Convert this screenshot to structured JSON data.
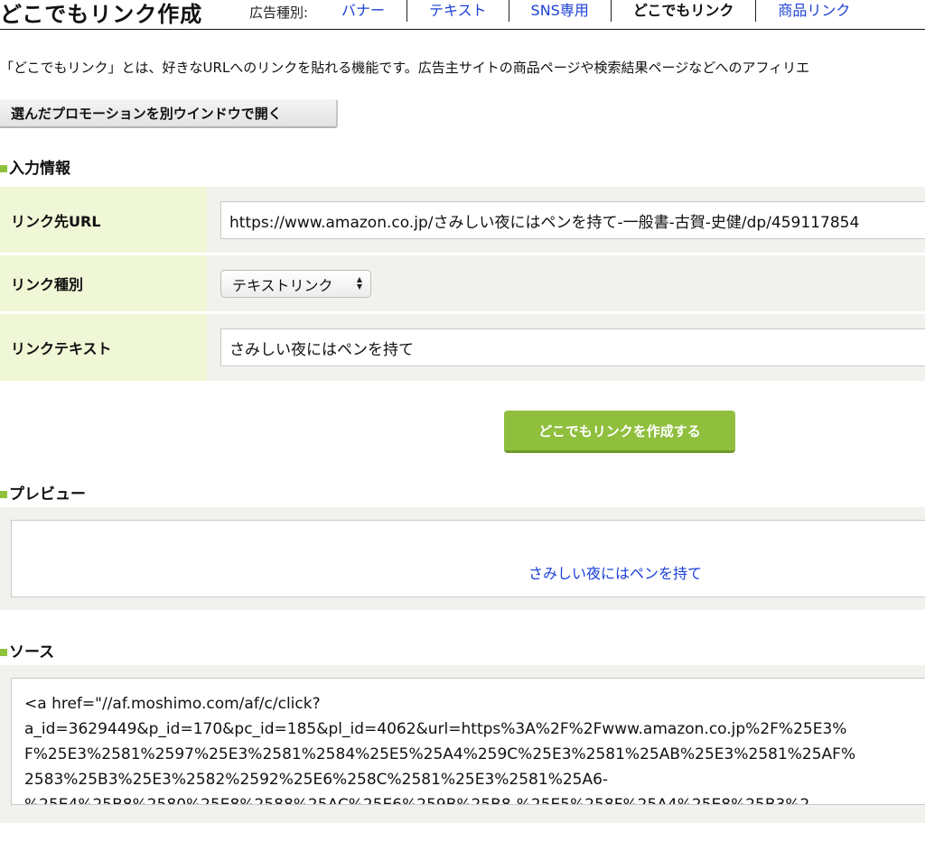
{
  "header": {
    "title": "どこでもリンク作成",
    "ad_type_label": "広告種別:",
    "tabs": [
      {
        "label": "バナー"
      },
      {
        "label": "テキスト"
      },
      {
        "label": "SNS専用"
      },
      {
        "label": "どこでもリンク"
      },
      {
        "label": "商品リンク"
      }
    ]
  },
  "intro_text": "「どこでもリンク」とは、好きなURLへのリンクを貼れる機能です。広告主サイトの商品ページや検索結果ページなどへのアフィリエ",
  "open_window_button": "選んだプロモーションを別ウインドウで開く",
  "input_section": {
    "heading": "入力情報",
    "url_label": "リンク先URL",
    "url_value": "https://www.amazon.co.jp/さみしい夜にはペンを持て-一般書-古賀-史健/dp/459117854",
    "type_label": "リンク種別",
    "type_selected": "テキストリンク",
    "text_label": "リンクテキスト",
    "text_value": "さみしい夜にはペンを持て"
  },
  "create_button": "どこでもリンクを作成する",
  "preview": {
    "heading": "プレビュー",
    "link_text": "さみしい夜にはペンを持て"
  },
  "source": {
    "heading": "ソース",
    "lines": [
      "<a href=\"//af.moshimo.com/af/c/click?",
      "a_id=3629449&p_id=170&pc_id=185&pl_id=4062&url=https%3A%2F%2Fwww.amazon.co.jp%2F%25E3%",
      "F%25E3%2581%2597%25E3%2581%2584%25E5%25A4%259C%25E3%2581%25AB%25E3%2581%25AF%",
      "2583%25B3%25E3%2582%2592%25E6%258C%2581%25E3%2581%25A6-",
      "%25E4%25B8%2580%25E8%2588%25AC%25E6%259B%25B8-%25E5%258F%25A4%25E8%25B3%2"
    ]
  },
  "colors": {
    "accent_green": "#8fbf3d",
    "label_bg": "#eff7d6",
    "link_blue": "#1a3fd6"
  }
}
